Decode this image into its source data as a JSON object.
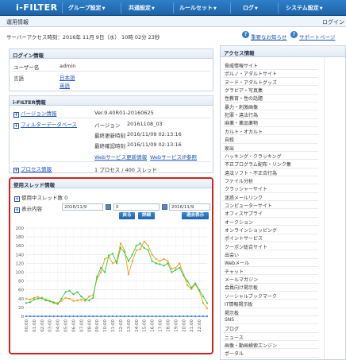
{
  "app": {
    "logo": "i-FILTER"
  },
  "nav": [
    {
      "label": "グループ設定"
    },
    {
      "label": "共通設定"
    },
    {
      "label": "ルールセット"
    },
    {
      "label": "ログ"
    },
    {
      "label": "システム設定"
    }
  ],
  "subbar": {
    "title": "運用情報",
    "right": "ログイン"
  },
  "access": {
    "text": "サーバーアクセス時刻：2016年 11月 9日（水） 10時 02分 23秒",
    "notice": "重要なお知らせ",
    "support": "サポートページ"
  },
  "login_info": {
    "title": "ログイン情報",
    "username_label": "ユーザー名",
    "username_value": "admin",
    "lang_label": "言語",
    "lang_ja": "日本語",
    "lang_en": "英語"
  },
  "ifilter_info": {
    "title": "i-FILTER情報",
    "version_label": "バージョン情報",
    "version_value": "Ver.9.40R01-20160625",
    "db_label": "フィルターデータベース",
    "db_version_label": "バージョン",
    "db_version_value": "20161108_03",
    "db_updated_label": "最終更新時刻",
    "db_updated_value": "2016/11/09 02:13:16",
    "db_checked_label": "最終確認時刻",
    "db_checked_value": "2016/11/09 02:13:16",
    "web_update_link": "Webサービス更新情報",
    "web_service_link": "WebサービスIP参照",
    "process_label": "プロセス情報",
    "process_value": "1 プロセス / 400 スレッド"
  },
  "thread_info": {
    "title": "使用スレッド情報",
    "count_label": "使用中スレッド数",
    "count_value": "0",
    "display_label": "表示内容",
    "date_from": "2016/11/9",
    "time_from": "0",
    "date_to": "2016/11/9",
    "btn_back": "戻る",
    "btn_detail": "詳細",
    "btn_past": "過去表示"
  },
  "chart_data": {
    "type": "line",
    "x": [
      "00:00",
      "00:30",
      "01:00",
      "01:30",
      "02:00",
      "02:30",
      "03:00",
      "03:30",
      "04:00",
      "04:30",
      "05:00",
      "05:30",
      "06:00",
      "06:30",
      "07:00",
      "07:30",
      "08:00",
      "08:30",
      "09:00",
      "09:30",
      "10:00",
      "10:30",
      "11:00",
      "11:30",
      "12:00",
      "12:30",
      "13:00",
      "13:30",
      "14:00",
      "14:30",
      "15:00",
      "15:30",
      "16:00",
      "16:30",
      "17:00",
      "17:30",
      "18:00",
      "18:30",
      "19:00",
      "19:30",
      "20:00",
      "20:30",
      "21:00",
      "21:30",
      "22:00",
      "22:30",
      "23:00"
    ],
    "ylim": [
      0,
      200
    ],
    "yticks": [
      0,
      20,
      40,
      60,
      80,
      100,
      120,
      140,
      160,
      180,
      200
    ],
    "xticks": [
      "00:00",
      "01:00",
      "02:00",
      "03:00",
      "04:00",
      "05:00",
      "06:00",
      "07:00",
      "08:00",
      "09:00",
      "10:00",
      "11:00",
      "12:00",
      "13:00",
      "14:00",
      "15:00",
      "16:00",
      "17:00",
      "18:00",
      "19:00",
      "20:00",
      "21:00",
      "22:00"
    ],
    "series": [
      {
        "color": "#f39c12",
        "values": [
          40,
          38,
          42,
          44,
          40,
          38,
          35,
          32,
          30,
          35,
          42,
          40,
          35,
          36,
          38,
          35,
          45,
          48,
          85,
          100,
          130,
          135,
          120,
          125,
          165,
          150,
          95,
          125,
          150,
          152,
          170,
          160,
          140,
          130,
          125,
          130,
          125,
          108,
          110,
          120,
          95,
          70,
          62,
          72,
          58,
          30,
          18
        ]
      },
      {
        "color": "#2ecc40",
        "values": [
          30,
          32,
          38,
          40,
          42,
          36,
          34,
          30,
          28,
          40,
          55,
          58,
          50,
          55,
          45,
          38,
          36,
          42,
          90,
          110,
          100,
          138,
          142,
          120,
          155,
          145,
          125,
          140,
          160,
          165,
          155,
          150,
          125,
          120,
          118,
          115,
          120,
          100,
          105,
          110,
          92,
          80,
          65,
          75,
          60,
          45,
          30
        ]
      },
      {
        "color": "#3a7bd5",
        "values": [
          0,
          0,
          0,
          0,
          0,
          0,
          0,
          0,
          0,
          0,
          0,
          0,
          0,
          0,
          0,
          0,
          0,
          0,
          0,
          0,
          0,
          0,
          0,
          0,
          0,
          0,
          0,
          0,
          0,
          0,
          0,
          0,
          0,
          0,
          0,
          0,
          0,
          0,
          0,
          0,
          0,
          0,
          0,
          0,
          0,
          0,
          0
        ]
      }
    ]
  },
  "categories": {
    "title": "アクセス情報",
    "items": [
      "脅威情報サイト",
      "ポルノ・アダルトサイト",
      "ヌード・アダルトグッズ",
      "グラビア・写真集",
      "性教育・性の話題",
      "暴力・刺激画像",
      "犯罪・違法行為",
      "麻薬・薬品薬物",
      "カルト・オカルト",
      "自殺",
      "家出",
      "ハッキング・クラッキング",
      "不正プログラム配布・リンク集",
      "違法ソフト・不正合行為",
      "ファイル分析",
      "クラッシャーサイト",
      "迷惑メールリンク",
      "コンピューターサイト",
      "オフィスサプライ",
      "オークション",
      "オンラインショッピング",
      "ポイントサービス",
      "クーポン総合サイト",
      "出会い",
      "Webメール",
      "チャット",
      "メールマガジン",
      "会員向け掲示板",
      "ソーシャルブックマーク",
      "IT情報掲示板",
      "掲示板",
      "SNS",
      "ブログ",
      "ニュース",
      "画像・動画検索エンジン",
      "ポータル"
    ]
  }
}
